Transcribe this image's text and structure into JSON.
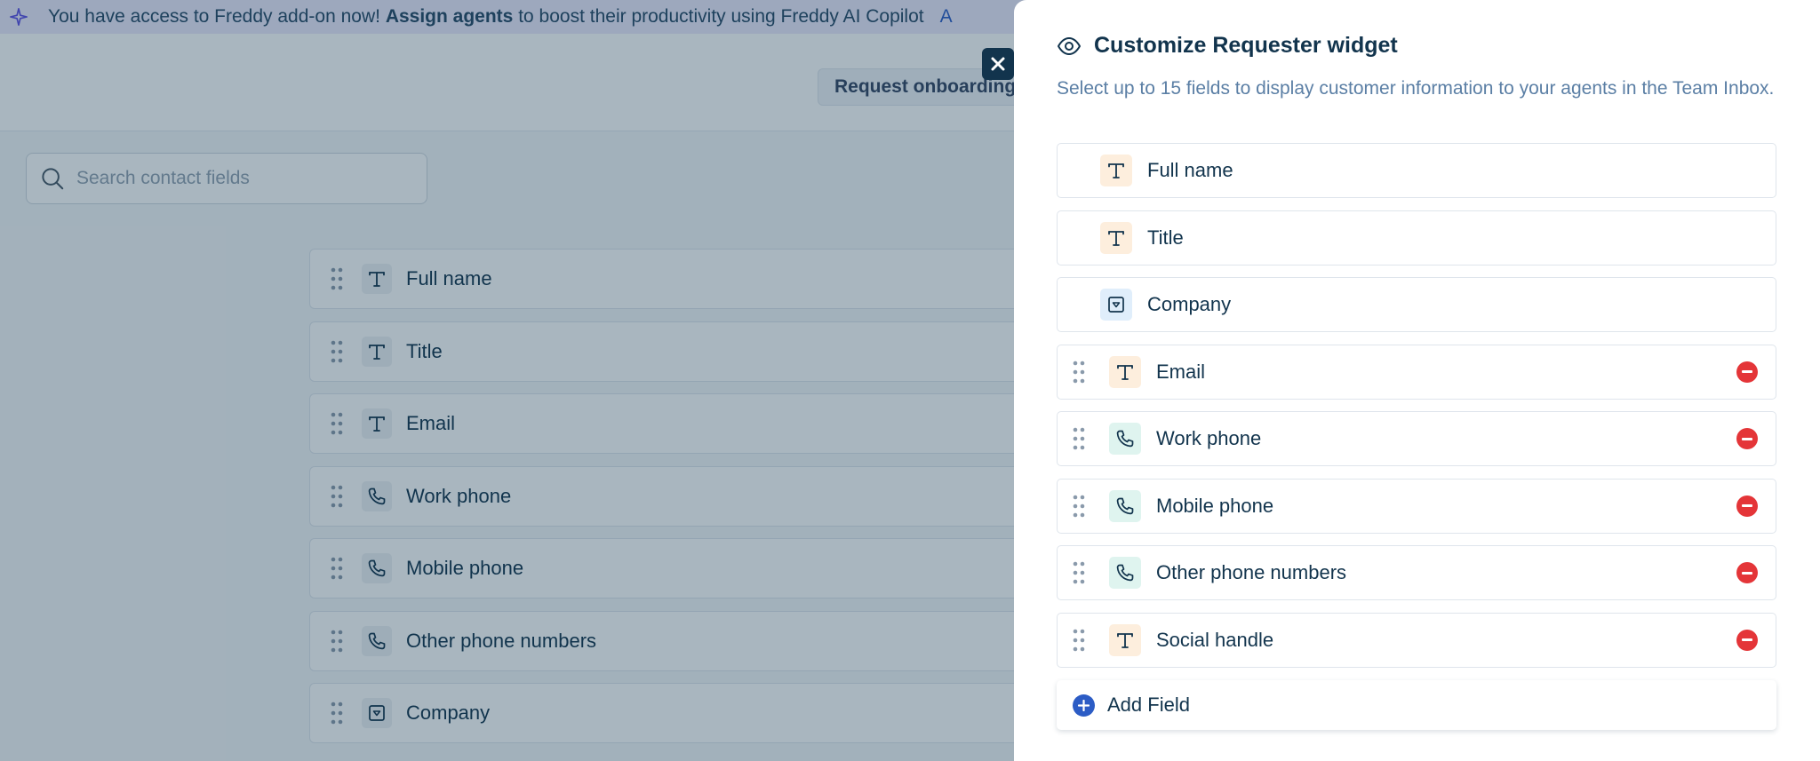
{
  "banner": {
    "text_prefix": "You have access to Freddy add-on now!",
    "text_bold": "Assign agents",
    "text_suffix": "to boost their productivity using Freddy AI Copilot",
    "text_trail": "A"
  },
  "topbar": {
    "request_onboarding_label": "Request onboarding"
  },
  "search": {
    "placeholder": "Search contact fields"
  },
  "background_fields": [
    {
      "label": "Full name",
      "type": "text"
    },
    {
      "label": "Title",
      "type": "text"
    },
    {
      "label": "Email",
      "type": "text"
    },
    {
      "label": "Work phone",
      "type": "phone"
    },
    {
      "label": "Mobile phone",
      "type": "phone"
    },
    {
      "label": "Other phone numbers",
      "type": "phone"
    },
    {
      "label": "Company",
      "type": "dropdown"
    }
  ],
  "panel": {
    "title": "Customize Requester widget",
    "description": "Select up to 15 fields to display customer information to your agents in the Team Inbox.",
    "fields": [
      {
        "label": "Full name",
        "type": "text",
        "removable": false
      },
      {
        "label": "Title",
        "type": "text",
        "removable": false
      },
      {
        "label": "Company",
        "type": "dropdown",
        "removable": false
      },
      {
        "label": "Email",
        "type": "text",
        "removable": true
      },
      {
        "label": "Work phone",
        "type": "phone",
        "removable": true
      },
      {
        "label": "Mobile phone",
        "type": "phone",
        "removable": true
      },
      {
        "label": "Other phone numbers",
        "type": "phone",
        "removable": true
      },
      {
        "label": "Social handle",
        "type": "text",
        "removable": true
      }
    ],
    "add_field_label": "Add Field"
  },
  "icons": {
    "text": "text-type-icon",
    "phone": "phone-icon",
    "dropdown": "dropdown-icon",
    "drag": "drag-handle-icon",
    "remove": "remove-icon",
    "close": "close-icon",
    "eye": "eye-icon",
    "add": "plus-circle-icon",
    "search": "search-icon",
    "sparkle": "sparkle-icon"
  },
  "colors": {
    "brand_blue": "#2c5cc5",
    "remove_red": "#e43538",
    "text_dark": "#12344d",
    "description_blue": "#5b7fa5",
    "text_icon_bg": "#fdeedd",
    "phone_icon_bg": "#dff4ef",
    "dropdown_icon_bg": "#e0eefb"
  }
}
